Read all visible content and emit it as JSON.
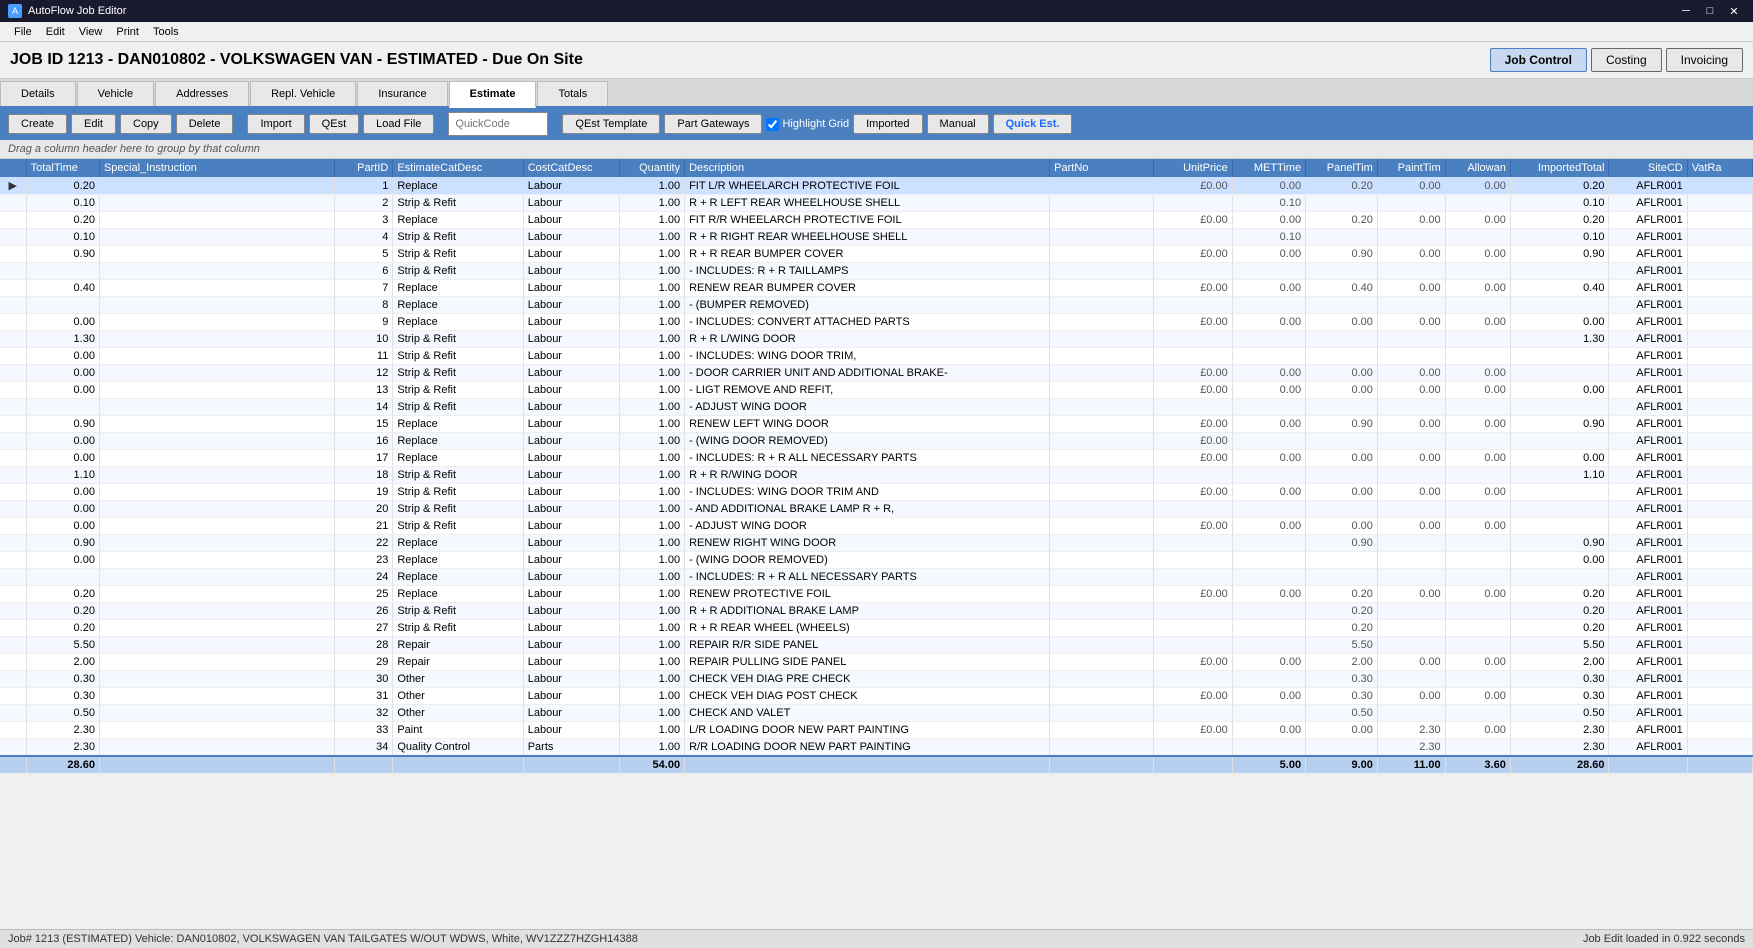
{
  "app": {
    "title": "AutoFlow Job Editor",
    "icon": "A"
  },
  "menu": {
    "items": [
      "File",
      "Edit",
      "View",
      "Print",
      "Tools"
    ]
  },
  "job": {
    "title": "JOB ID 1213 - DAN010802 - VOLKSWAGEN VAN - ESTIMATED - Due On Site"
  },
  "header_buttons": [
    {
      "label": "Job Control",
      "active": false
    },
    {
      "label": "Costing",
      "active": false
    },
    {
      "label": "Invoicing",
      "active": false
    }
  ],
  "tabs": [
    {
      "label": "Details",
      "active": false
    },
    {
      "label": "Vehicle",
      "active": false
    },
    {
      "label": "Addresses",
      "active": false
    },
    {
      "label": "Repl. Vehicle",
      "active": false
    },
    {
      "label": "Insurance",
      "active": false
    },
    {
      "label": "Estimate",
      "active": true
    },
    {
      "label": "Totals",
      "active": false
    }
  ],
  "toolbar": {
    "buttons": [
      "Create",
      "Edit",
      "Copy",
      "Delete",
      "Import",
      "QEst",
      "Load File"
    ],
    "quickcode_placeholder": "QuickCode",
    "qest_template": "QEst Template",
    "part_gateways": "Part Gateways",
    "highlight_grid": "Highlight Grid",
    "imported": "Imported",
    "manual": "Manual",
    "quick_est": "Quick Est."
  },
  "group_bar": "Drag a column header here to group by that column",
  "columns": [
    "TotalTime",
    "Special_Instruction",
    "PartID",
    "EstimateCatDesc",
    "CostCatDesc",
    "Quantity",
    "Description",
    "PartNo",
    "UnitPrice",
    "METTime",
    "PanelTim",
    "PaintTim",
    "Allowan",
    "ImportedTotal",
    "SiteCD",
    "VatRa"
  ],
  "rows": [
    {
      "arrow": "▶",
      "totaltime": "0.20",
      "special": "",
      "partid": "1",
      "estcat": "Replace",
      "costcat": "Labour",
      "qty": "1.00",
      "desc": "FIT L/R WHEELARCH PROTECTIVE FOIL",
      "partno": "",
      "unitprice": "£0.00",
      "met": "0.00",
      "panel": "0.20",
      "paint": "0.00",
      "allowan": "0.00",
      "imported": "0.20",
      "sitecd": "AFLR001",
      "vatr": ""
    },
    {
      "arrow": "",
      "totaltime": "0.10",
      "special": "",
      "partid": "2",
      "estcat": "Strip & Refit",
      "costcat": "Labour",
      "qty": "1.00",
      "desc": "R + R LEFT REAR WHEELHOUSE SHELL",
      "partno": "",
      "unitprice": "",
      "met": "0.10",
      "panel": "",
      "paint": "",
      "allowan": "",
      "imported": "0.10",
      "sitecd": "AFLR001",
      "vatr": ""
    },
    {
      "arrow": "",
      "totaltime": "0.20",
      "special": "",
      "partid": "3",
      "estcat": "Replace",
      "costcat": "Labour",
      "qty": "1.00",
      "desc": "FIT R/R WHEELARCH PROTECTIVE FOIL",
      "partno": "",
      "unitprice": "£0.00",
      "met": "0.00",
      "panel": "0.20",
      "paint": "0.00",
      "allowan": "0.00",
      "imported": "0.20",
      "sitecd": "AFLR001",
      "vatr": ""
    },
    {
      "arrow": "",
      "totaltime": "0.10",
      "special": "",
      "partid": "4",
      "estcat": "Strip & Refit",
      "costcat": "Labour",
      "qty": "1.00",
      "desc": "R + R RIGHT REAR WHEELHOUSE SHELL",
      "partno": "",
      "unitprice": "",
      "met": "0.10",
      "panel": "",
      "paint": "",
      "allowan": "",
      "imported": "0.10",
      "sitecd": "AFLR001",
      "vatr": ""
    },
    {
      "arrow": "",
      "totaltime": "0.90",
      "special": "",
      "partid": "5",
      "estcat": "Strip & Refit",
      "costcat": "Labour",
      "qty": "1.00",
      "desc": "R + R REAR BUMPER COVER",
      "partno": "",
      "unitprice": "£0.00",
      "met": "0.00",
      "panel": "0.90",
      "paint": "0.00",
      "allowan": "0.00",
      "imported": "0.90",
      "sitecd": "AFLR001",
      "vatr": ""
    },
    {
      "arrow": "",
      "totaltime": "",
      "special": "",
      "partid": "6",
      "estcat": "Strip & Refit",
      "costcat": "Labour",
      "qty": "1.00",
      "desc": "- INCLUDES: R + R TAILLAMPS",
      "partno": "",
      "unitprice": "",
      "met": "",
      "panel": "",
      "paint": "",
      "allowan": "",
      "imported": "",
      "sitecd": "AFLR001",
      "vatr": ""
    },
    {
      "arrow": "",
      "totaltime": "0.40",
      "special": "",
      "partid": "7",
      "estcat": "Replace",
      "costcat": "Labour",
      "qty": "1.00",
      "desc": "RENEW REAR BUMPER COVER",
      "partno": "",
      "unitprice": "£0.00",
      "met": "0.00",
      "panel": "0.40",
      "paint": "0.00",
      "allowan": "0.00",
      "imported": "0.40",
      "sitecd": "AFLR001",
      "vatr": ""
    },
    {
      "arrow": "",
      "totaltime": "",
      "special": "",
      "partid": "8",
      "estcat": "Replace",
      "costcat": "Labour",
      "qty": "1.00",
      "desc": "- (BUMPER REMOVED)",
      "partno": "",
      "unitprice": "",
      "met": "",
      "panel": "",
      "paint": "",
      "allowan": "",
      "imported": "",
      "sitecd": "AFLR001",
      "vatr": ""
    },
    {
      "arrow": "",
      "totaltime": "0.00",
      "special": "",
      "partid": "9",
      "estcat": "Replace",
      "costcat": "Labour",
      "qty": "1.00",
      "desc": "- INCLUDES: CONVERT ATTACHED PARTS",
      "partno": "",
      "unitprice": "£0.00",
      "met": "0.00",
      "panel": "0.00",
      "paint": "0.00",
      "allowan": "0.00",
      "imported": "0.00",
      "sitecd": "AFLR001",
      "vatr": ""
    },
    {
      "arrow": "",
      "totaltime": "1.30",
      "special": "",
      "partid": "10",
      "estcat": "Strip & Refit",
      "costcat": "Labour",
      "qty": "1.00",
      "desc": "R + R L/WING DOOR",
      "partno": "",
      "unitprice": "",
      "met": "",
      "panel": "",
      "paint": "",
      "allowan": "",
      "imported": "1.30",
      "sitecd": "AFLR001",
      "vatr": ""
    },
    {
      "arrow": "",
      "totaltime": "0.00",
      "special": "",
      "partid": "11",
      "estcat": "Strip & Refit",
      "costcat": "Labour",
      "qty": "1.00",
      "desc": "- INCLUDES: WING DOOR TRIM,",
      "partno": "",
      "unitprice": "",
      "met": "",
      "panel": "",
      "paint": "",
      "allowan": "",
      "imported": "",
      "sitecd": "AFLR001",
      "vatr": ""
    },
    {
      "arrow": "",
      "totaltime": "0.00",
      "special": "",
      "partid": "12",
      "estcat": "Strip & Refit",
      "costcat": "Labour",
      "qty": "1.00",
      "desc": "- DOOR CARRIER UNIT AND ADDITIONAL BRAKE-",
      "partno": "",
      "unitprice": "£0.00",
      "met": "0.00",
      "panel": "0.00",
      "paint": "0.00",
      "allowan": "0.00",
      "imported": "",
      "sitecd": "AFLR001",
      "vatr": ""
    },
    {
      "arrow": "",
      "totaltime": "0.00",
      "special": "",
      "partid": "13",
      "estcat": "Strip & Refit",
      "costcat": "Labour",
      "qty": "1.00",
      "desc": "- LIGT REMOVE AND REFIT,",
      "partno": "",
      "unitprice": "£0.00",
      "met": "0.00",
      "panel": "0.00",
      "paint": "0.00",
      "allowan": "0.00",
      "imported": "0.00",
      "sitecd": "AFLR001",
      "vatr": ""
    },
    {
      "arrow": "",
      "totaltime": "",
      "special": "",
      "partid": "14",
      "estcat": "Strip & Refit",
      "costcat": "Labour",
      "qty": "1.00",
      "desc": "- ADJUST WING DOOR",
      "partno": "",
      "unitprice": "",
      "met": "",
      "panel": "",
      "paint": "",
      "allowan": "",
      "imported": "",
      "sitecd": "AFLR001",
      "vatr": ""
    },
    {
      "arrow": "",
      "totaltime": "0.90",
      "special": "",
      "partid": "15",
      "estcat": "Replace",
      "costcat": "Labour",
      "qty": "1.00",
      "desc": "RENEW LEFT WING DOOR",
      "partno": "",
      "unitprice": "£0.00",
      "met": "0.00",
      "panel": "0.90",
      "paint": "0.00",
      "allowan": "0.00",
      "imported": "0.90",
      "sitecd": "AFLR001",
      "vatr": ""
    },
    {
      "arrow": "",
      "totaltime": "0.00",
      "special": "",
      "partid": "16",
      "estcat": "Replace",
      "costcat": "Labour",
      "qty": "1.00",
      "desc": "- (WING DOOR REMOVED)",
      "partno": "",
      "unitprice": "£0.00",
      "met": "",
      "panel": "",
      "paint": "",
      "allowan": "",
      "imported": "",
      "sitecd": "AFLR001",
      "vatr": ""
    },
    {
      "arrow": "",
      "totaltime": "0.00",
      "special": "",
      "partid": "17",
      "estcat": "Replace",
      "costcat": "Labour",
      "qty": "1.00",
      "desc": "- INCLUDES: R + R ALL NECESSARY PARTS",
      "partno": "",
      "unitprice": "£0.00",
      "met": "0.00",
      "panel": "0.00",
      "paint": "0.00",
      "allowan": "0.00",
      "imported": "0.00",
      "sitecd": "AFLR001",
      "vatr": ""
    },
    {
      "arrow": "",
      "totaltime": "1.10",
      "special": "",
      "partid": "18",
      "estcat": "Strip & Refit",
      "costcat": "Labour",
      "qty": "1.00",
      "desc": "R + R R/WING DOOR",
      "partno": "",
      "unitprice": "",
      "met": "",
      "panel": "",
      "paint": "",
      "allowan": "",
      "imported": "1.10",
      "sitecd": "AFLR001",
      "vatr": ""
    },
    {
      "arrow": "",
      "totaltime": "0.00",
      "special": "",
      "partid": "19",
      "estcat": "Strip & Refit",
      "costcat": "Labour",
      "qty": "1.00",
      "desc": "- INCLUDES: WING DOOR TRIM AND",
      "partno": "",
      "unitprice": "£0.00",
      "met": "0.00",
      "panel": "0.00",
      "paint": "0.00",
      "allowan": "0.00",
      "imported": "",
      "sitecd": "AFLR001",
      "vatr": ""
    },
    {
      "arrow": "",
      "totaltime": "0.00",
      "special": "",
      "partid": "20",
      "estcat": "Strip & Refit",
      "costcat": "Labour",
      "qty": "1.00",
      "desc": "- AND ADDITIONAL BRAKE LAMP R + R,",
      "partno": "",
      "unitprice": "",
      "met": "",
      "panel": "",
      "paint": "",
      "allowan": "",
      "imported": "",
      "sitecd": "AFLR001",
      "vatr": ""
    },
    {
      "arrow": "",
      "totaltime": "0.00",
      "special": "",
      "partid": "21",
      "estcat": "Strip & Refit",
      "costcat": "Labour",
      "qty": "1.00",
      "desc": "- ADJUST WING DOOR",
      "partno": "",
      "unitprice": "£0.00",
      "met": "0.00",
      "panel": "0.00",
      "paint": "0.00",
      "allowan": "0.00",
      "imported": "",
      "sitecd": "AFLR001",
      "vatr": ""
    },
    {
      "arrow": "",
      "totaltime": "0.90",
      "special": "",
      "partid": "22",
      "estcat": "Replace",
      "costcat": "Labour",
      "qty": "1.00",
      "desc": "RENEW RIGHT WING DOOR",
      "partno": "",
      "unitprice": "",
      "met": "",
      "panel": "0.90",
      "paint": "",
      "allowan": "",
      "imported": "0.90",
      "sitecd": "AFLR001",
      "vatr": ""
    },
    {
      "arrow": "",
      "totaltime": "0.00",
      "special": "",
      "partid": "23",
      "estcat": "Replace",
      "costcat": "Labour",
      "qty": "1.00",
      "desc": "- (WING DOOR REMOVED)",
      "partno": "",
      "unitprice": "",
      "met": "",
      "panel": "",
      "paint": "",
      "allowan": "",
      "imported": "0.00",
      "sitecd": "AFLR001",
      "vatr": ""
    },
    {
      "arrow": "",
      "totaltime": "",
      "special": "",
      "partid": "24",
      "estcat": "Replace",
      "costcat": "Labour",
      "qty": "1.00",
      "desc": "- INCLUDES: R + R ALL NECESSARY PARTS",
      "partno": "",
      "unitprice": "",
      "met": "",
      "panel": "",
      "paint": "",
      "allowan": "",
      "imported": "",
      "sitecd": "AFLR001",
      "vatr": ""
    },
    {
      "arrow": "",
      "totaltime": "0.20",
      "special": "",
      "partid": "25",
      "estcat": "Replace",
      "costcat": "Labour",
      "qty": "1.00",
      "desc": "RENEW PROTECTIVE FOIL",
      "partno": "",
      "unitprice": "£0.00",
      "met": "0.00",
      "panel": "0.20",
      "paint": "0.00",
      "allowan": "0.00",
      "imported": "0.20",
      "sitecd": "AFLR001",
      "vatr": ""
    },
    {
      "arrow": "",
      "totaltime": "0.20",
      "special": "",
      "partid": "26",
      "estcat": "Strip & Refit",
      "costcat": "Labour",
      "qty": "1.00",
      "desc": "R + R ADDITIONAL BRAKE LAMP",
      "partno": "",
      "unitprice": "",
      "met": "",
      "panel": "0.20",
      "paint": "",
      "allowan": "",
      "imported": "0.20",
      "sitecd": "AFLR001",
      "vatr": ""
    },
    {
      "arrow": "",
      "totaltime": "0.20",
      "special": "",
      "partid": "27",
      "estcat": "Strip & Refit",
      "costcat": "Labour",
      "qty": "1.00",
      "desc": "R + R REAR WHEEL (WHEELS)",
      "partno": "",
      "unitprice": "",
      "met": "",
      "panel": "0.20",
      "paint": "",
      "allowan": "",
      "imported": "0.20",
      "sitecd": "AFLR001",
      "vatr": ""
    },
    {
      "arrow": "",
      "totaltime": "5.50",
      "special": "",
      "partid": "28",
      "estcat": "Repair",
      "costcat": "Labour",
      "qty": "1.00",
      "desc": "REPAIR R/R SIDE PANEL",
      "partno": "",
      "unitprice": "",
      "met": "",
      "panel": "5.50",
      "paint": "",
      "allowan": "",
      "imported": "5.50",
      "sitecd": "AFLR001",
      "vatr": ""
    },
    {
      "arrow": "",
      "totaltime": "2.00",
      "special": "",
      "partid": "29",
      "estcat": "Repair",
      "costcat": "Labour",
      "qty": "1.00",
      "desc": "REPAIR PULLING SIDE PANEL",
      "partno": "",
      "unitprice": "£0.00",
      "met": "0.00",
      "panel": "2.00",
      "paint": "0.00",
      "allowan": "0.00",
      "imported": "2.00",
      "sitecd": "AFLR001",
      "vatr": ""
    },
    {
      "arrow": "",
      "totaltime": "0.30",
      "special": "",
      "partid": "30",
      "estcat": "Other",
      "costcat": "Labour",
      "qty": "1.00",
      "desc": "CHECK VEH DIAG PRE CHECK",
      "partno": "",
      "unitprice": "",
      "met": "",
      "panel": "0.30",
      "paint": "",
      "allowan": "",
      "imported": "0.30",
      "sitecd": "AFLR001",
      "vatr": ""
    },
    {
      "arrow": "",
      "totaltime": "0.30",
      "special": "",
      "partid": "31",
      "estcat": "Other",
      "costcat": "Labour",
      "qty": "1.00",
      "desc": "CHECK VEH DIAG POST CHECK",
      "partno": "",
      "unitprice": "£0.00",
      "met": "0.00",
      "panel": "0.30",
      "paint": "0.00",
      "allowan": "0.00",
      "imported": "0.30",
      "sitecd": "AFLR001",
      "vatr": ""
    },
    {
      "arrow": "",
      "totaltime": "0.50",
      "special": "",
      "partid": "32",
      "estcat": "Other",
      "costcat": "Labour",
      "qty": "1.00",
      "desc": "CHECK AND VALET",
      "partno": "",
      "unitprice": "",
      "met": "",
      "panel": "0.50",
      "paint": "",
      "allowan": "",
      "imported": "0.50",
      "sitecd": "AFLR001",
      "vatr": ""
    },
    {
      "arrow": "",
      "totaltime": "2.30",
      "special": "",
      "partid": "33",
      "estcat": "Paint",
      "costcat": "Labour",
      "qty": "1.00",
      "desc": "L/R LOADING DOOR NEW PART PAINTING",
      "partno": "",
      "unitprice": "£0.00",
      "met": "0.00",
      "panel": "0.00",
      "paint": "2.30",
      "allowan": "0.00",
      "imported": "2.30",
      "sitecd": "AFLR001",
      "vatr": ""
    },
    {
      "arrow": "",
      "totaltime": "2.30",
      "special": "",
      "partid": "34",
      "estcat": "Quality Control",
      "costcat": "Parts",
      "qty": "1.00",
      "desc": "R/R LOADING DOOR NEW PART PAINTING",
      "partno": "",
      "unitprice": "",
      "met": "",
      "panel": "",
      "paint": "2.30",
      "allowan": "",
      "imported": "2.30",
      "sitecd": "AFLR001",
      "vatr": ""
    }
  ],
  "totals_row": {
    "totaltime": "28.60",
    "qty": "54.00",
    "met": "5.00",
    "panel": "9.00",
    "paint": "11.00",
    "allowan": "3.60",
    "imported": "28.60"
  },
  "status_bar": {
    "left": "Job# 1213 (ESTIMATED)    Vehicle: DAN010802, VOLKSWAGEN VAN TAILGATES W/OUT WDWS, White, WV1ZZZ7HZGH14388",
    "right": "Job Edit loaded in 0.922 seconds"
  }
}
